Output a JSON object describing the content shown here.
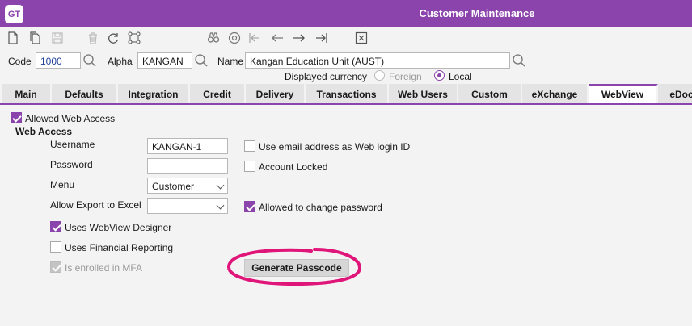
{
  "app": {
    "logo": "GT",
    "title": "Customer Maintenance"
  },
  "toolbar": {
    "icons": [
      "new-icon",
      "copy-icon",
      "save-icon",
      "delete-icon",
      "refresh-icon",
      "link-icon",
      "find-icon",
      "navigate-icon",
      "first-icon",
      "prev-icon",
      "next-icon",
      "last-icon",
      "close-icon"
    ]
  },
  "header": {
    "code_label": "Code",
    "code_value": "1000",
    "alpha_label": "Alpha",
    "alpha_value": "KANGAN",
    "name_label": "Name",
    "name_value": "Kangan Education Unit (AUST)",
    "currency_label": "Displayed currency",
    "currency_options": [
      "Foreign",
      "Local"
    ],
    "currency_selected": "Local"
  },
  "tabs": [
    "Main",
    "Defaults",
    "Integration",
    "Credit",
    "Delivery",
    "Transactions",
    "Web Users",
    "Custom",
    "eXchange",
    "WebView",
    "eDoc"
  ],
  "active_tab": "WebView",
  "webview": {
    "allowed_web_access_label": "Allowed Web Access",
    "allowed_web_access": true,
    "section_title": "Web Access",
    "username_label": "Username",
    "username_value": "KANGAN-1",
    "password_label": "Password",
    "password_value": "",
    "menu_label": "Menu",
    "menu_value": "Customer",
    "allow_export_label": "Allow Export to Excel",
    "allow_export_value": "",
    "use_email_label": "Use email address as Web login ID",
    "use_email": false,
    "account_locked_label": "Account Locked",
    "account_locked": false,
    "allowed_change_password_label": "Allowed to change password",
    "allowed_change_password": true,
    "uses_webview_designer_label": "Uses WebView Designer",
    "uses_webview_designer": true,
    "uses_financial_reporting_label": "Uses Financial Reporting",
    "uses_financial_reporting": false,
    "enrolled_mfa_label": "Is enrolled in MFA",
    "enrolled_mfa": true,
    "generate_passcode_label": "Generate Passcode"
  },
  "colors": {
    "accent": "#8b44ac",
    "highlight": "#e0157a"
  }
}
